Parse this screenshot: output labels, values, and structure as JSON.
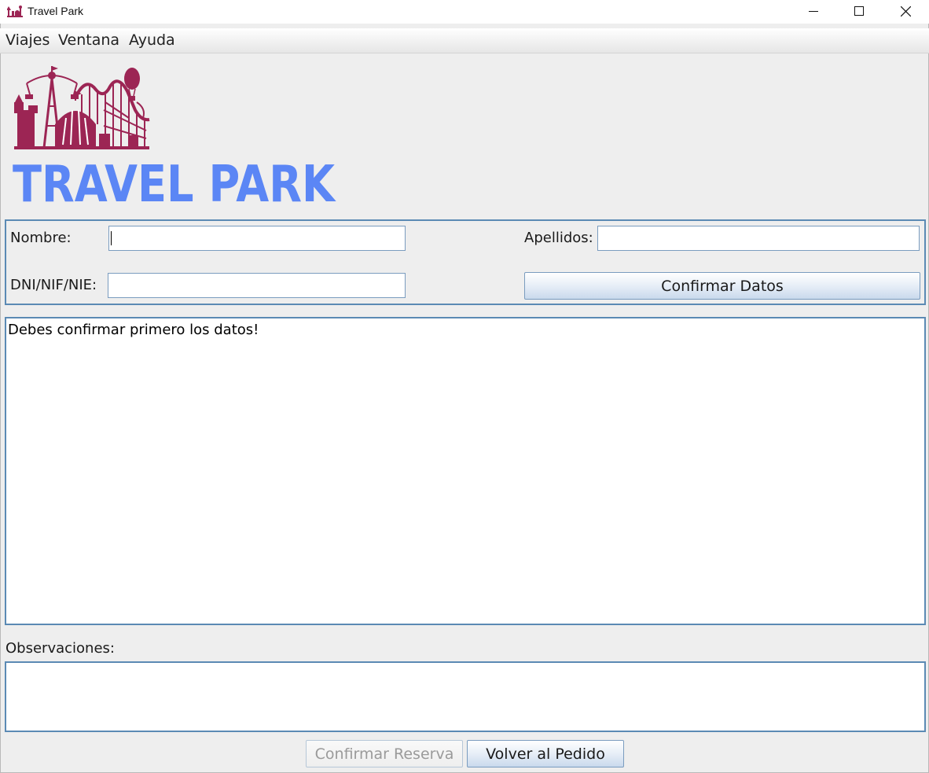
{
  "window": {
    "title": "Travel Park",
    "controls": [
      "minimize",
      "maximize",
      "close"
    ]
  },
  "menu": {
    "items": [
      {
        "label": "Viajes"
      },
      {
        "label": "Ventana"
      },
      {
        "label": "Ayuda"
      }
    ]
  },
  "logo": {
    "text": "TRAVEL PARK",
    "text_color": "#5b86f5",
    "illustration_color": "#9c2554"
  },
  "form": {
    "nombre_label": "Nombre:",
    "nombre_value": "",
    "apellidos_label": "Apellidos:",
    "apellidos_value": "",
    "dni_label": "DNI/NIF/NIE:",
    "dni_value": "",
    "confirm_data_button": "Confirmar Datos"
  },
  "message": {
    "text": "Debes confirmar primero los datos!"
  },
  "observaciones": {
    "label": "Observaciones:",
    "value": ""
  },
  "buttons": {
    "confirm_reservation": "Confirmar Reserva",
    "confirm_reservation_enabled": false,
    "back_to_order": "Volver al Pedido"
  },
  "colors": {
    "panel_border": "#5b8ab4",
    "background": "#eeeeee"
  }
}
